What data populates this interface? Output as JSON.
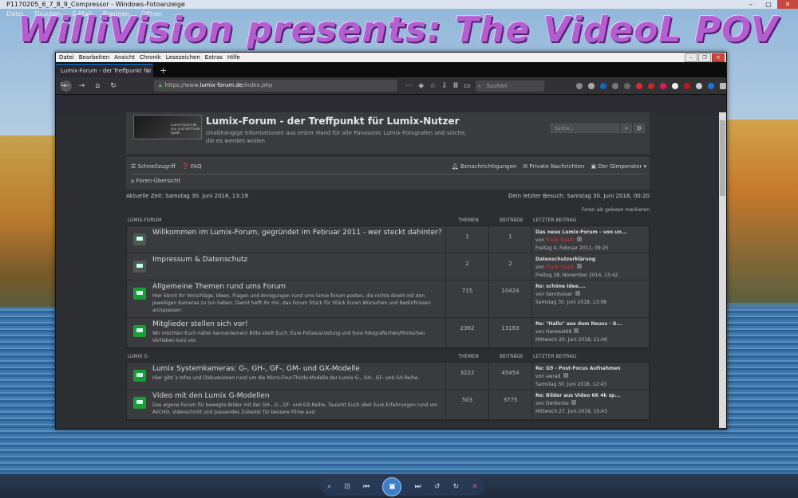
{
  "viewer": {
    "title": "P1170205_6_7_8_9_Compressor - Windows-Fotoanzeige",
    "menu": [
      "Datei",
      "Drucken",
      "E-Mail",
      "Brennen",
      "Öffnen"
    ],
    "overlay_text": "WilliVision presents: The VideoL POV"
  },
  "browser": {
    "menu": [
      "Datei",
      "Bearbeiten",
      "Ansicht",
      "Chronik",
      "Lesezeichen",
      "Extras",
      "Hilfe"
    ],
    "tab_title": "Lumix-Forum - der Treffpunkt für L",
    "url_prefix": "https://www.",
    "url_host": "lumix-forum.de",
    "url_path": "/index.php",
    "search_placeholder": "Suchen"
  },
  "forum": {
    "title": "Lumix-Forum - der Treffpunkt für Lumix-Nutzer",
    "description": "Unabhängige Informationen aus erster Hand für alle Panasonic Lumix-Fotografen und solche, die es werden wollen",
    "search_placeholder": "Suche...",
    "logo_text": "Lumix-Forum.de von und mit Frank Späth",
    "nav": {
      "quicklinks": "Schnellzugriff",
      "faq": "FAQ",
      "notifications": "Benachrichtigungen",
      "messages": "Private Nachrichten",
      "user": "Der GImperator"
    },
    "breadcrumb": "Foren-Übersicht",
    "current_time": "Aktuelle Zeit: Samstag 30. Juni 2018, 13:19",
    "last_visit": "Dein letzter Besuch: Samstag 30. Juni 2018, 00:20",
    "mark_read": "Foren als gelesen markieren",
    "columns": {
      "topics": "THEMEN",
      "posts": "BEITRÄGE",
      "last": "LETZTER BEITRAG"
    },
    "categories": [
      {
        "name": "LUMIX-FORUM",
        "forums": [
          {
            "title": "Willkommen im Lumix-Forum, gegründet im Februar 2011 - wer steckt dahinter?",
            "desc": "",
            "topics": "1",
            "posts": "1",
            "last_title": "Das neue Lumix-Forum – von un...",
            "last_by": "von",
            "last_user": "Frank Späth",
            "last_date": "Freitag 4. Februar 2011, 09:25",
            "user_red": true,
            "icon": "grey"
          },
          {
            "title": "Impressum & Datenschutz",
            "desc": "",
            "topics": "2",
            "posts": "2",
            "last_title": "Datenschutzerklärung",
            "last_by": "von",
            "last_user": "Frank Späth",
            "last_date": "Freitag 28. November 2014, 13:42",
            "user_red": true,
            "icon": "grey"
          },
          {
            "title": "Allgemeine Themen rund ums Forum",
            "desc": "Hier könnt Ihr Vorschläge, Ideen, Fragen und Anregungen rund ums lumix-forum posten, die nichts direkt mit den jeweiligen Kameras zu tun haben. Damit helft Ihr mir, das Forum Stück für Stück Euren Wünschen und Bedürfnissen anzupassen.",
            "topics": "715",
            "posts": "10424",
            "last_title": "Re: schöne Idee....",
            "last_by": "von",
            "last_user": "Sennheiser",
            "last_date": "Samstag 30. Juni 2018, 13:08",
            "user_red": false,
            "icon": "green"
          },
          {
            "title": "Mitglieder stellen sich vor!",
            "desc": "Wir möchten Euch näher kennenlernen! Bitte stellt Euch, Eure Fotoausrüstung und Eure fotografischen/filmischen Vorlieben kurz vor.",
            "topics": "2362",
            "posts": "13163",
            "last_title": "Re: \"Hallo\" aus dem Neuss - G...",
            "last_by": "von",
            "last_user": "Hanseat68",
            "last_date": "Mittwoch 20. Juni 2018, 21:46",
            "user_red": false,
            "icon": "green"
          }
        ]
      },
      {
        "name": "LUMIX G",
        "forums": [
          {
            "title": "Lumix Systemkameras: G-, GH-, GF-, GM- und GX-Modelle",
            "desc": "Hier gibt´s Infos und Diskussionen rund um die Micro-Four-Thirds-Modelle der Lumix G-, GH-, GF- und GX-Reihe.",
            "topics": "3222",
            "posts": "45454",
            "last_title": "Re: G9 - Post-Focus Aufnahmen",
            "last_by": "von",
            "last_user": "awrad",
            "last_date": "Samstag 30. Juni 2018, 12:43",
            "user_red": false,
            "icon": "green"
          },
          {
            "title": "Video mit den Lumix G-Modellen",
            "desc": "Das eigene Forum für bewegte Bilder mit der GH-, G-, GF- und GX-Reihe. Tauscht Euch über Eure Erfahrungen rund um AVCHD, Videoschnitt und passendes Zubehör für bessere Filme aus!",
            "topics": "503",
            "posts": "3775",
            "last_title": "Re: Bilder aus Video 6K 4k sp...",
            "last_by": "von",
            "last_user": "DerBecke",
            "last_date": "Mittwoch 27. Juni 2018, 10:43",
            "user_red": false,
            "icon": "green"
          }
        ]
      }
    ]
  },
  "colors": {
    "accent": "#0a84ff",
    "forum_bg": "#2d2e31",
    "panel": "#3a3b3f",
    "unread_icon": "#1e9a36",
    "overlay": "#b45fd0"
  }
}
